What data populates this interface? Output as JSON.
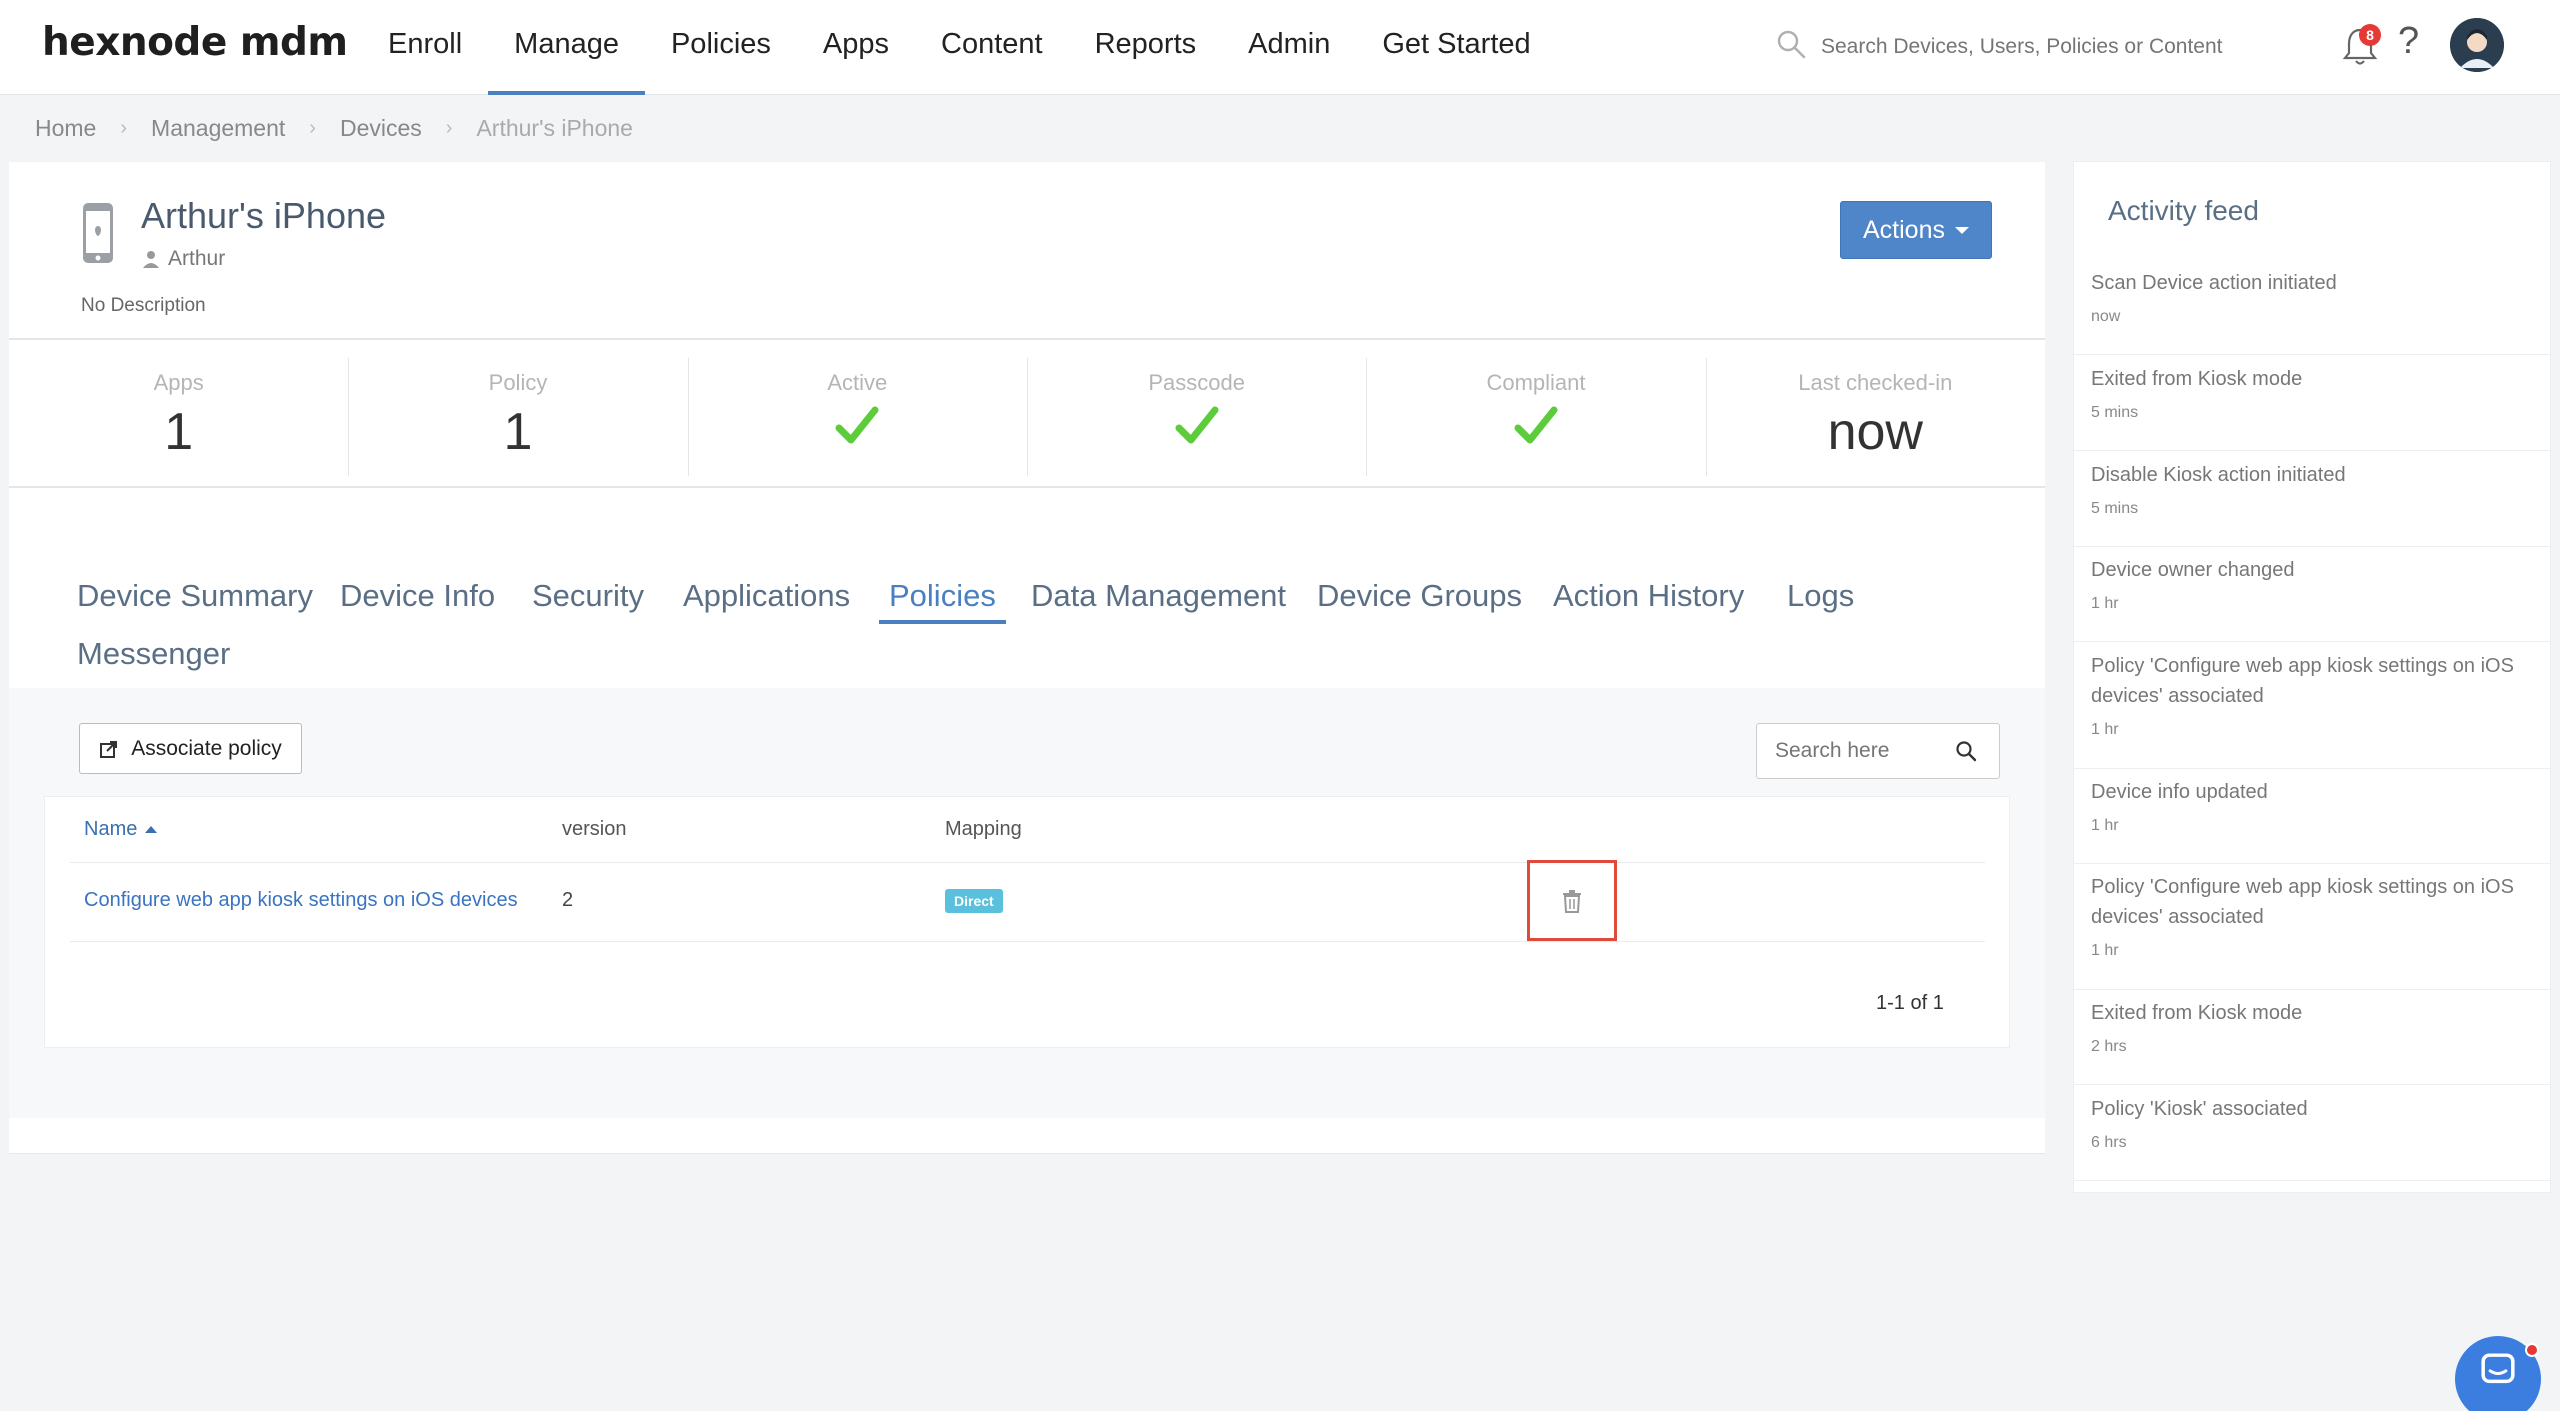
{
  "app": {
    "logo": "hexnode mdm"
  },
  "nav": {
    "items": [
      "Enroll",
      "Manage",
      "Policies",
      "Apps",
      "Content",
      "Reports",
      "Admin",
      "Get Started"
    ],
    "active_index": 1,
    "search_placeholder": "Search Devices, Users, Policies or Content",
    "notification_count": "8",
    "help_label": "?"
  },
  "breadcrumb": [
    "Home",
    "Management",
    "Devices",
    "Arthur's iPhone"
  ],
  "device": {
    "name": "Arthur's iPhone",
    "user": "Arthur",
    "description": "No Description",
    "actions_label": "Actions"
  },
  "stats": [
    {
      "label": "Apps",
      "value": "1"
    },
    {
      "label": "Policy",
      "value": "1"
    },
    {
      "label": "Active",
      "value": "check"
    },
    {
      "label": "Passcode",
      "value": "check"
    },
    {
      "label": "Compliant",
      "value": "check"
    },
    {
      "label": "Last checked-in",
      "value": "now"
    }
  ],
  "tabs": [
    "Device Summary",
    "Device Info",
    "Security",
    "Applications",
    "Policies",
    "Data Management",
    "Device Groups",
    "Action History",
    "Logs",
    "Messenger"
  ],
  "active_tab": "Policies",
  "policies": {
    "associate_label": "Associate policy",
    "search_placeholder": "Search here",
    "columns": [
      "Name",
      "version",
      "Mapping"
    ],
    "rows": [
      {
        "name": "Configure web app kiosk settings on iOS devices",
        "version": "2",
        "mapping": "Direct"
      }
    ],
    "pagination": "1-1 of 1"
  },
  "activity_feed": {
    "title": "Activity feed",
    "items": [
      {
        "text": "Scan Device action initiated",
        "time": "now"
      },
      {
        "text": "Exited from Kiosk mode",
        "time": "5 mins"
      },
      {
        "text": "Disable Kiosk action initiated",
        "time": "5 mins"
      },
      {
        "text": "Device owner changed",
        "time": "1 hr"
      },
      {
        "text": "Policy 'Configure web app kiosk settings on iOS devices' associated",
        "time": "1 hr"
      },
      {
        "text": "Device info updated",
        "time": "1 hr"
      },
      {
        "text": "Policy 'Configure web app kiosk settings on iOS devices' associated",
        "time": "1 hr"
      },
      {
        "text": "Exited from Kiosk mode",
        "time": "2 hrs"
      },
      {
        "text": "Policy 'Kiosk' associated",
        "time": "6 hrs"
      }
    ]
  },
  "colors": {
    "accent": "#4a7fc1",
    "check": "#5ccc3a",
    "highlight": "#e04a3a",
    "badge": "#5bc0de"
  }
}
